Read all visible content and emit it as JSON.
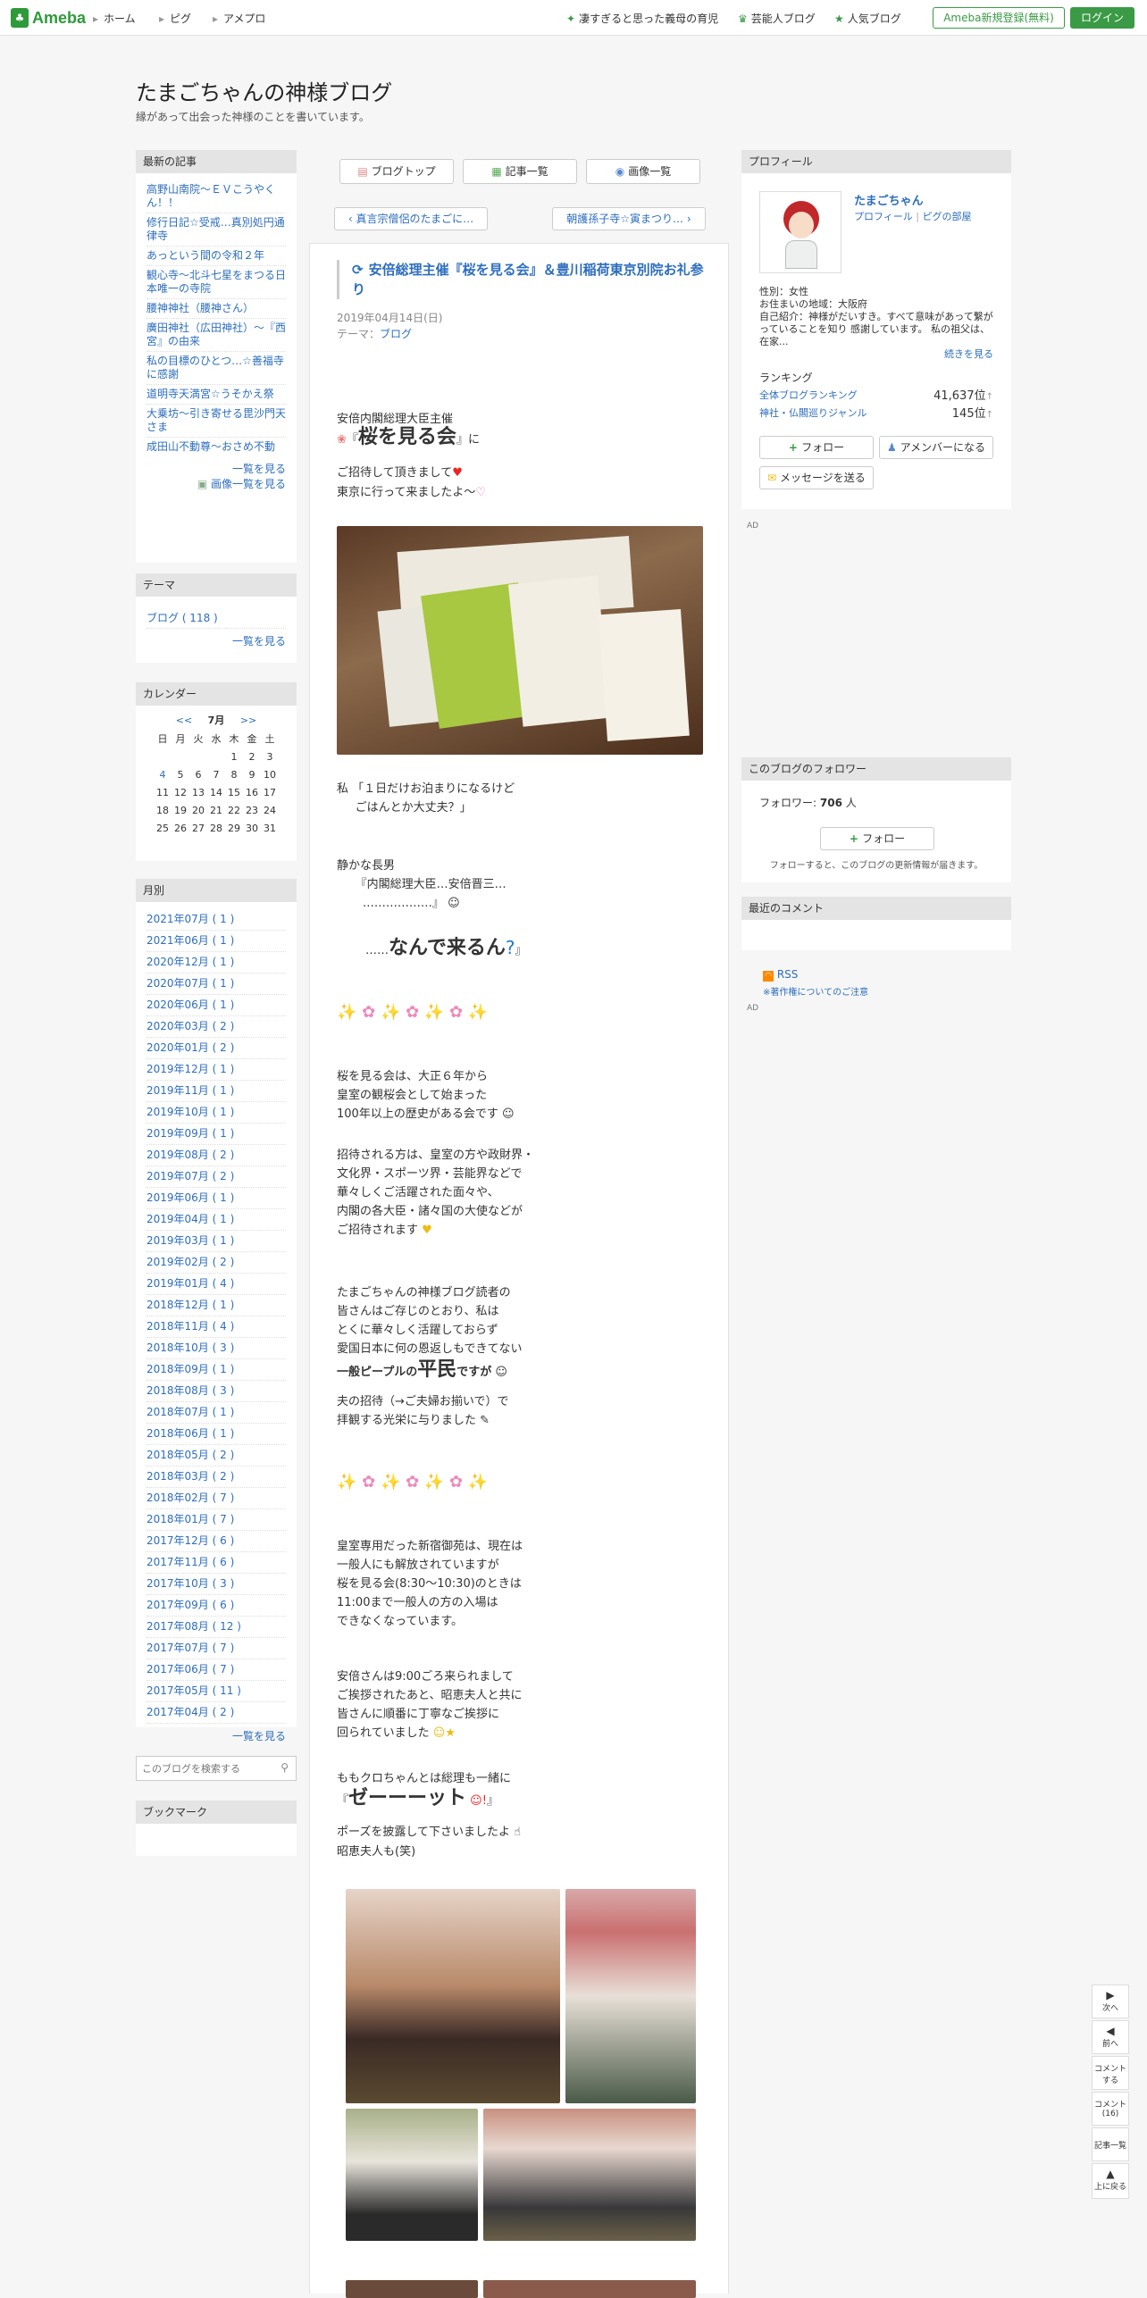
{
  "topbar": {
    "logo": "Ameba",
    "nav": [
      "ホーム",
      "ピグ",
      "アメプロ"
    ],
    "links": [
      "凄すぎると思った義母の育児",
      "芸能人ブログ",
      "人気ブログ"
    ],
    "register": "Ameba新規登録(無料)",
    "login": "ログイン"
  },
  "blog": {
    "title": "たまごちゃんの神様ブログ",
    "description": "縁があって出会った神様のことを書いています。"
  },
  "sidebar_recent": {
    "heading": "最新の記事",
    "items": [
      "高野山南院～ＥＶこうやくん！！",
      "修行日記☆受戒…真別処円通律寺",
      "あっという間の令和２年",
      "観心寺～北斗七星をまつる日本唯一の寺院",
      "腰神神社（腰神さん）",
      "廣田神社（広田神社）～『西宮』の由来",
      "私の目標のひとつ…☆善福寺に感謝",
      "道明寺天満宮☆うそかえ祭",
      "大乗坊～引き寄せる毘沙門天さま",
      "成田山不動尊～おさめ不動"
    ],
    "more": "一覧を見る",
    "images": "画像一覧を見る"
  },
  "sidebar_theme": {
    "heading": "テーマ",
    "items": [
      "ブログ ( 118 )"
    ],
    "more": "一覧を見る"
  },
  "sidebar_calendar": {
    "heading": "カレンダー",
    "prev": "<<",
    "month": "7月",
    "next": ">>",
    "weekdays": [
      "日",
      "月",
      "火",
      "水",
      "木",
      "金",
      "土"
    ],
    "weeks": [
      [
        "",
        "",
        "",
        "",
        "1",
        "2",
        "3"
      ],
      [
        "4",
        "5",
        "6",
        "7",
        "8",
        "9",
        "10"
      ],
      [
        "11",
        "12",
        "13",
        "14",
        "15",
        "16",
        "17"
      ],
      [
        "18",
        "19",
        "20",
        "21",
        "22",
        "23",
        "24"
      ],
      [
        "25",
        "26",
        "27",
        "28",
        "29",
        "30",
        "31"
      ]
    ]
  },
  "sidebar_archive": {
    "heading": "月別",
    "items": [
      "2021年07月 ( 1 )",
      "2021年06月 ( 1 )",
      "2020年12月 ( 1 )",
      "2020年07月 ( 1 )",
      "2020年06月 ( 1 )",
      "2020年03月 ( 2 )",
      "2020年01月 ( 2 )",
      "2019年12月 ( 1 )",
      "2019年11月 ( 1 )",
      "2019年10月 ( 1 )",
      "2019年09月 ( 1 )",
      "2019年08月 ( 2 )",
      "2019年07月 ( 2 )",
      "2019年06月 ( 1 )",
      "2019年04月 ( 1 )",
      "2019年03月 ( 1 )",
      "2019年02月 ( 2 )",
      "2019年01月 ( 4 )",
      "2018年12月 ( 1 )",
      "2018年11月 ( 4 )",
      "2018年10月 ( 3 )",
      "2018年09月 ( 1 )",
      "2018年08月 ( 3 )",
      "2018年07月 ( 1 )",
      "2018年06月 ( 1 )",
      "2018年05月 ( 2 )",
      "2018年03月 ( 2 )",
      "2018年02月 ( 7 )",
      "2018年01月 ( 7 )",
      "2017年12月 ( 6 )",
      "2017年11月 ( 6 )",
      "2017年10月 ( 3 )",
      "2017年09月 ( 6 )",
      "2017年08月 ( 12 )",
      "2017年07月 ( 7 )",
      "2017年06月 ( 7 )",
      "2017年05月 ( 11 )",
      "2017年04月 ( 2 )"
    ],
    "more": "一覧を見る"
  },
  "search": {
    "placeholder": "このブログを検索する"
  },
  "bookmark": {
    "heading": "ブックマーク"
  },
  "article": {
    "nav": [
      "ブログトップ",
      "記事一覧",
      "画像一覧"
    ],
    "prev": "真言宗僧侶のたまごに…",
    "next": "朝護孫子寺☆寅まつり…",
    "title": "安倍総理主催『桜を見る会』＆豊川稲荷東京別院お礼参り",
    "date": "2019年04月14日(日)",
    "theme_label": "テーマ：",
    "theme": "ブログ",
    "p1": "安倍内閣総理大臣主催",
    "p2a": "『",
    "p2b": "桜を見る会",
    "p2c": "』に",
    "p3": "ご招待して頂きまして",
    "p4": "東京に行って来ましたよ～",
    "p5": "私 「１日だけお泊まりになるけど\n     ごはんとか大丈夫？」",
    "p6": "静かな長男\n     『内閣総理大臣…安倍晋三…\n       ………………』",
    "p7a": "……",
    "p7b": "なんで来るん",
    "p7c": "』",
    "p8": "桜を見る会は、大正６年から\n皇室の観桜会として始まった\n100年以上の歴史がある会です",
    "p9": "招待される方は、皇室の方や政財界・\n文化界・スポーツ界・芸能界などで\n華々しくご活躍された面々や、\n内閣の各大臣・諸々国の大使などが\nご招待されます",
    "p10": "たまごちゃんの神様ブログ読者の\n皆さんはご存じのとおり、私は\nとくに華々しく活躍しておらず\n愛国日本に何の恩返しもできてない",
    "p11a": "一般ピープルの",
    "p11b": "平民",
    "p11c": "ですが",
    "p12": "夫の招待（→ご夫婦お揃いで）で\n拝観する光栄に与りました",
    "p13": "皇室専用だった新宿御苑は、現在は\n一般人にも解放されていますが\n桜を見る会(8:30～10:30)のときは\n11:00まで一般人の方の入場は\nできなくなっています。",
    "p14": "安倍さんは9:00ごろ来られまして\nご挨拶されたあと、昭恵夫人と共に\n皆さんに順番に丁寧なご挨拶に\n回られていました",
    "p15": "ももクロちゃんとは総理も一緒に",
    "p16a": "『",
    "p16b": "ゼーーーット",
    "p16c": "』",
    "p17": "ポーズを披露して下さいましたよ",
    "p18": "昭恵夫人も(笑)"
  },
  "profile": {
    "heading": "プロフィール",
    "name": "たまごちゃん",
    "profile_link": "プロフィール",
    "pig_link": "ピグの部屋",
    "gender": "性別：女性",
    "area": "お住まいの地域：大阪府",
    "intro": "自己紹介：神様がだいすき。すべて意味があって繋がっていることを知り 感謝しています。 私の祖父は、在家...",
    "more": "続きを見る",
    "ranking_label": "ランキング",
    "rank1_label": "全体ブログランキング",
    "rank1_value": "41,637位",
    "rank2_label": "神社・仏閣巡りジャンル",
    "rank2_value": "145位",
    "follow": "フォロー",
    "member": "アメンバーになる",
    "message": "メッセージを送る"
  },
  "ad": "AD",
  "followers": {
    "heading": "このブログのフォロワー",
    "count_label": "フォロワー:",
    "count": "706",
    "unit": "人",
    "follow": "フォロー",
    "note": "フォローすると、このブログの更新情報が届きます。"
  },
  "comments": {
    "heading": "最近のコメント"
  },
  "rss": {
    "label": "RSS",
    "copyright": "※著作権についてのご注意"
  },
  "floatnav": {
    "next": "次へ",
    "prev": "前へ",
    "comment": "コメントする",
    "comments": "コメント(16)",
    "list": "記事一覧",
    "top": "上に戻る"
  },
  "colors": {
    "accent": "#3a9a45",
    "link": "#2d6ebf"
  }
}
